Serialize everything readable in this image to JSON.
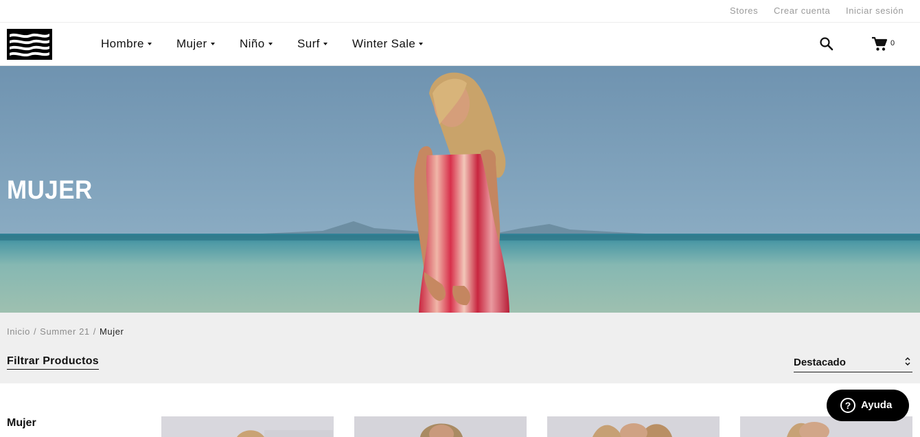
{
  "topbar": {
    "links": [
      "Stores",
      "Crear cuenta",
      "Iniciar sesión"
    ]
  },
  "header": {
    "logo_icon": "billabong-logo-icon",
    "nav": [
      "Hombre",
      "Mujer",
      "Niño",
      "Surf",
      "Winter Sale"
    ],
    "search_icon": "search-icon",
    "cart_icon": "cart-icon",
    "cart_count": "0"
  },
  "hero": {
    "title": "MUJER"
  },
  "breadcrumb": [
    "Inicio",
    "Summer 21",
    "Mujer"
  ],
  "filters": {
    "filter_label": "Filtrar Productos",
    "sort_value": "Destacado"
  },
  "sidebar": {
    "title": "Mujer"
  },
  "help": {
    "label": "Ayuda"
  },
  "colors": {
    "accent": "#000000",
    "muted_text": "#9a9a9a",
    "filter_bg": "#efefef"
  }
}
